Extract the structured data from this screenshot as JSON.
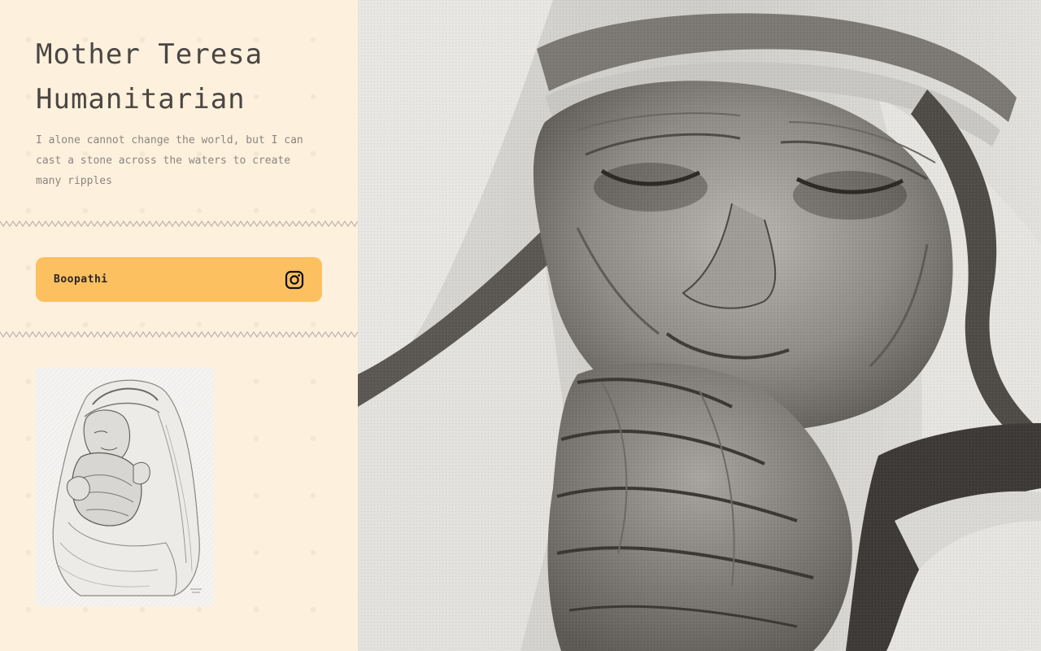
{
  "hero": {
    "title_line1": "Mother Teresa",
    "title_line2": "Humanitarian",
    "quote": "I alone cannot change the world, but I can cast a stone across the waters to create many ripples"
  },
  "social": {
    "name": "Boopathi",
    "icon": "instagram-icon"
  },
  "colors": {
    "background": "#fdf1dd",
    "card": "#fdc060",
    "title_text": "#4a4643",
    "quote_text": "#8c8580"
  }
}
